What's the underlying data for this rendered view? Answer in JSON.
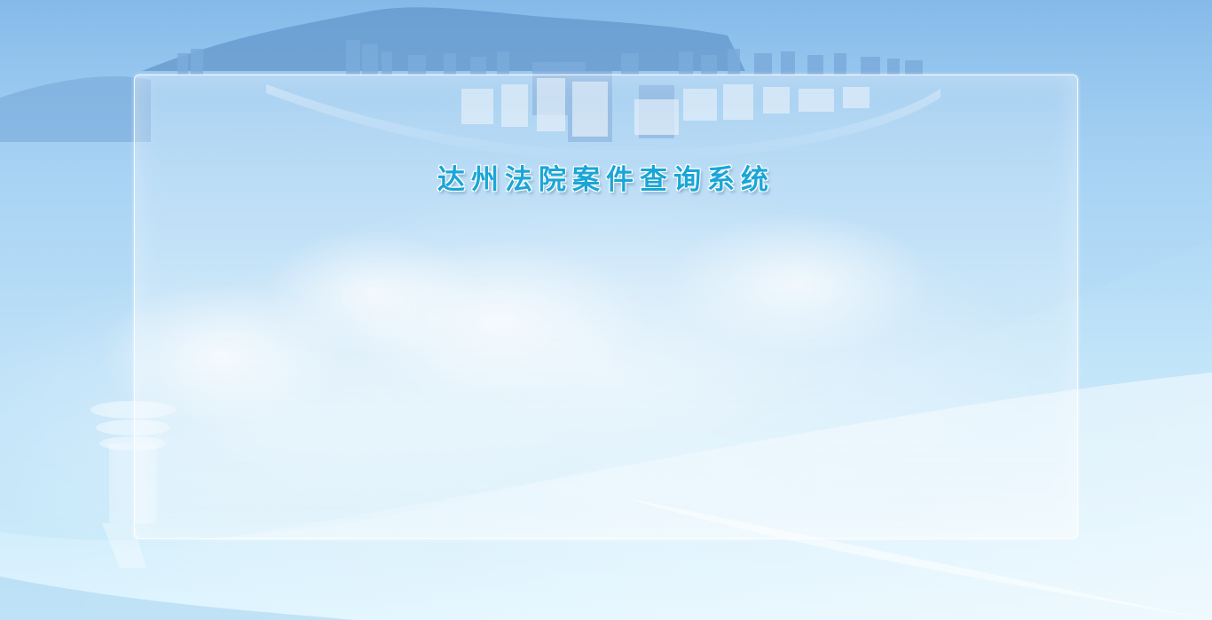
{
  "page": {
    "title": "达州法院案件查询系统"
  },
  "colors": {
    "sky_top": "#8fc2ee",
    "sky_bottom": "#cfeefc",
    "title_text": "#1aa6d6",
    "panel_border": "#ffffff"
  },
  "decorations": {
    "skyline": "city-skyline-image",
    "statue": "justice-pillar-image",
    "swoosh": "light-swoosh-background"
  }
}
